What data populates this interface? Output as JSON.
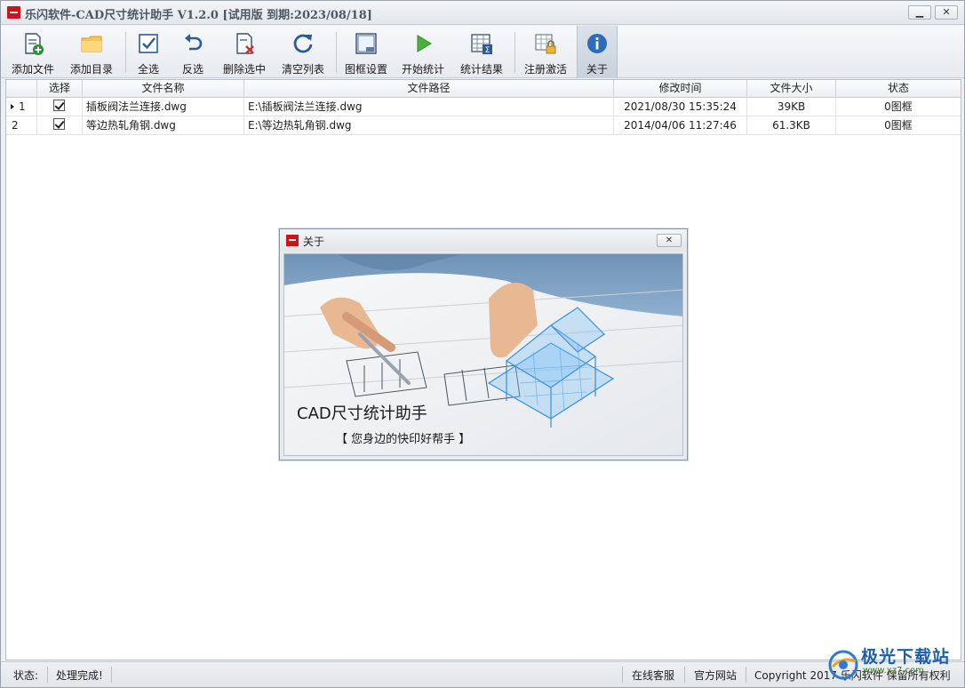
{
  "window": {
    "title": "乐闪软件-CAD尺寸统计助手 V1.2.0 [试用版 到期:2023/08/18]",
    "minimize_icon": "minimize-icon",
    "close_icon": "close-icon"
  },
  "toolbar": {
    "items": [
      {
        "label": "添加文件",
        "icon": "add-file-icon"
      },
      {
        "label": "添加目录",
        "icon": "folder-icon"
      },
      {
        "label": "全选",
        "icon": "check-all-icon"
      },
      {
        "label": "反选",
        "icon": "undo-icon"
      },
      {
        "label": "删除选中",
        "icon": "delete-file-icon"
      },
      {
        "label": "清空列表",
        "icon": "refresh-icon"
      },
      {
        "label": "图框设置",
        "icon": "frame-icon"
      },
      {
        "label": "开始统计",
        "icon": "play-icon"
      },
      {
        "label": "统计结果",
        "icon": "table-sum-icon"
      },
      {
        "label": "注册激活",
        "icon": "lock-icon"
      },
      {
        "label": "关于",
        "icon": "info-icon"
      }
    ],
    "active": "关于"
  },
  "grid": {
    "columns": [
      "",
      "选择",
      "文件名称",
      "文件路径",
      "修改时间",
      "文件大小",
      "状态"
    ],
    "rows": [
      {
        "index": "1",
        "checked": true,
        "name": "插板阀法兰连接.dwg",
        "path": "E:\\插板阀法兰连接.dwg",
        "modified": "2021/08/30 15:35:24",
        "size": "39KB",
        "status": "0图框",
        "current": true
      },
      {
        "index": "2",
        "checked": true,
        "name": "等边热轧角钢.dwg",
        "path": "E:\\等边热轧角钢.dwg",
        "modified": "2014/04/06 11:27:46",
        "size": "61.3KB",
        "status": "0图框",
        "current": false
      }
    ]
  },
  "dialog": {
    "title": "关于",
    "banner_title": "CAD尺寸统计助手",
    "banner_subtitle": "【 您身边的快印好帮手 】"
  },
  "statusbar": {
    "label": "状态:",
    "message": "处理完成!",
    "online_service": "在线客服",
    "website": "官方网站",
    "copyright": "Copyright 2017 乐闪软件 保留所有权利"
  },
  "watermark": {
    "text": "极光下载站",
    "url": "www.xz7.com"
  },
  "colors": {
    "accent": "#1f6fc7",
    "brand_red": "#c8161d"
  }
}
